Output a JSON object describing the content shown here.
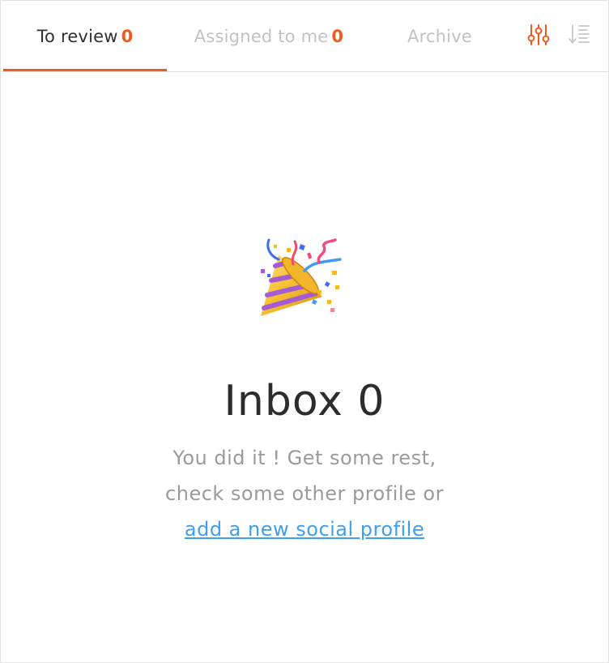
{
  "tabs": [
    {
      "label": "To review",
      "count": "0",
      "active": true
    },
    {
      "label": "Assigned to me",
      "count": "0",
      "active": false
    },
    {
      "label": "Archive",
      "count": "",
      "active": false
    }
  ],
  "toolbar": {
    "filter_icon": "sliders-icon",
    "sort_icon": "sort-list-icon"
  },
  "empty_state": {
    "illustration": "party-popper-icon",
    "title": "Inbox 0",
    "message_line1": "You did it ! Get some rest,",
    "message_line2": "check some other profile or",
    "link_text": "add a new social profile"
  },
  "colors": {
    "accent": "#f05a1e",
    "link": "#3c9ff0",
    "inactive_tab": "#c2c2c2",
    "text_dark": "#2b2b30",
    "text_muted": "#9a9a9a"
  }
}
